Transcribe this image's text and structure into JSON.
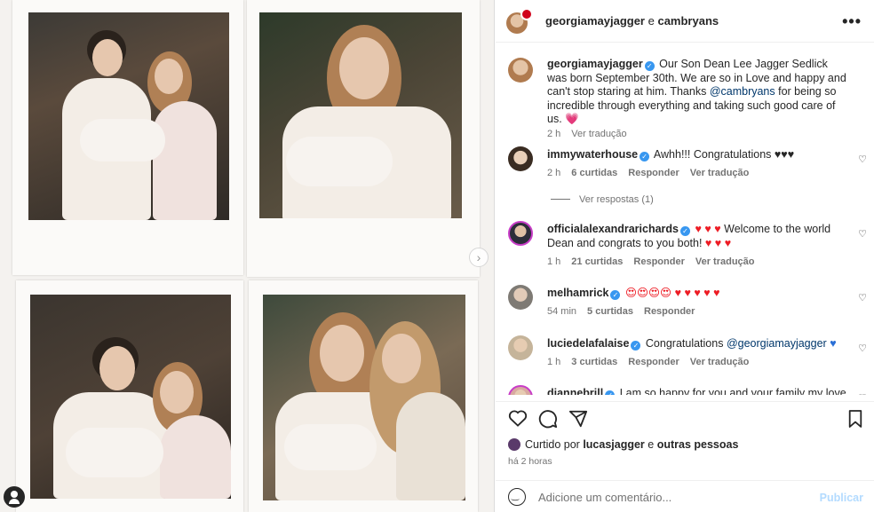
{
  "header": {
    "user1": "georgiamayjagger",
    "connector": " e ",
    "user2": "cambryans",
    "more": "•••"
  },
  "caption": {
    "user": "georgiamayjagger",
    "text": " Our Son Dean Lee Jagger Sedlick was born September 30th. We are so in Love and happy and can't stop staring at him. Thanks ",
    "mention": "@cambryans",
    "text2": " for being so incredible through everything and taking such good care of us. ",
    "emoji": "💗",
    "time": "2 h",
    "translate": "Ver tradução"
  },
  "comments": [
    {
      "user": "immywaterhouse",
      "text": " Awhh!!! Congratulations ",
      "hearts": "♥♥♥",
      "time": "2 h",
      "likes": "6 curtidas",
      "reply": "Responder",
      "translate": "Ver tradução"
    },
    {
      "user": "officialalexandrarichards",
      "hearts1": "♥ ♥ ♥",
      "text": " Welcome to the world Dean and congrats to you both! ",
      "hearts2": "♥ ♥ ♥",
      "time": "1 h",
      "likes": "21 curtidas",
      "reply": "Responder",
      "translate": "Ver tradução"
    },
    {
      "user": "melhamrick",
      "emojis": "😍😍😍😍 ♥ ♥ ♥ ♥ ♥",
      "time": "54 min",
      "likes": "5 curtidas",
      "reply": "Responder"
    },
    {
      "user": "luciedelafalaise",
      "text": " Congratulations ",
      "mention": "@georgiamayjagger",
      "heart": "♥",
      "time": "1 h",
      "likes": "3 curtidas",
      "reply": "Responder",
      "translate": "Ver tradução"
    },
    {
      "user": "diannebrill",
      "text": " I am so happy for you and your family my love"
    }
  ],
  "replies_label": "Ver respostas (1)",
  "liked": {
    "prefix": "Curtido por ",
    "user": "lucasjagger",
    "mid": " e ",
    "others": "outras pessoas"
  },
  "time_ago": "há 2 horas",
  "add_comment": {
    "placeholder": "Adicione um comentário...",
    "publish": "Publicar"
  },
  "icons": {
    "like": "heart-icon",
    "comment": "comment-icon",
    "share": "send-icon",
    "save": "bookmark-icon"
  },
  "colors": {
    "link": "#00376b",
    "verified": "#3897f0",
    "red_heart": "#ed1c24",
    "publish": "#b3dbff"
  }
}
